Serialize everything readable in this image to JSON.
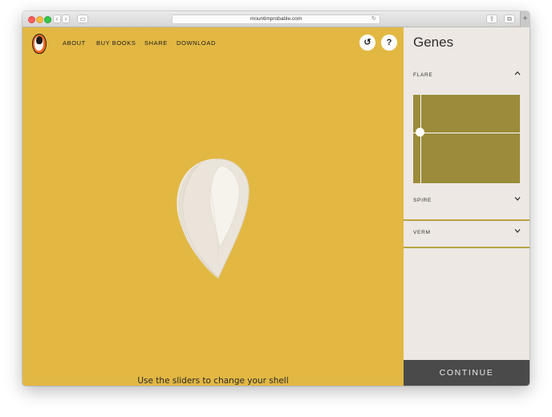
{
  "browser": {
    "url": "mountimprobable.com",
    "back_glyph": "‹",
    "forward_glyph": "›",
    "sidebar_glyph": "▭",
    "reload_glyph": "↻",
    "share_glyph": "⇪",
    "tabs_glyph": "⧉",
    "new_tab_glyph": "+"
  },
  "nav": {
    "items": [
      {
        "label": "ABOUT"
      },
      {
        "label": "BUY BOOKS"
      },
      {
        "label": "SHARE"
      },
      {
        "label": "DOWNLOAD"
      }
    ]
  },
  "toolbar": {
    "reset_glyph": "↺",
    "help_glyph": "?"
  },
  "main": {
    "hint": "Use the sliders to change your shell"
  },
  "panel": {
    "title": "Genes",
    "genes": [
      {
        "label": "FLARE",
        "expanded": true
      },
      {
        "label": "SPIRE",
        "expanded": false
      },
      {
        "label": "VERM",
        "expanded": false
      }
    ],
    "continue_label": "CONTINUE"
  },
  "colors": {
    "background": "#e2b843",
    "panel": "#ede8e3",
    "slider": "#9b8b3a",
    "continue": "#4a4a4a"
  }
}
